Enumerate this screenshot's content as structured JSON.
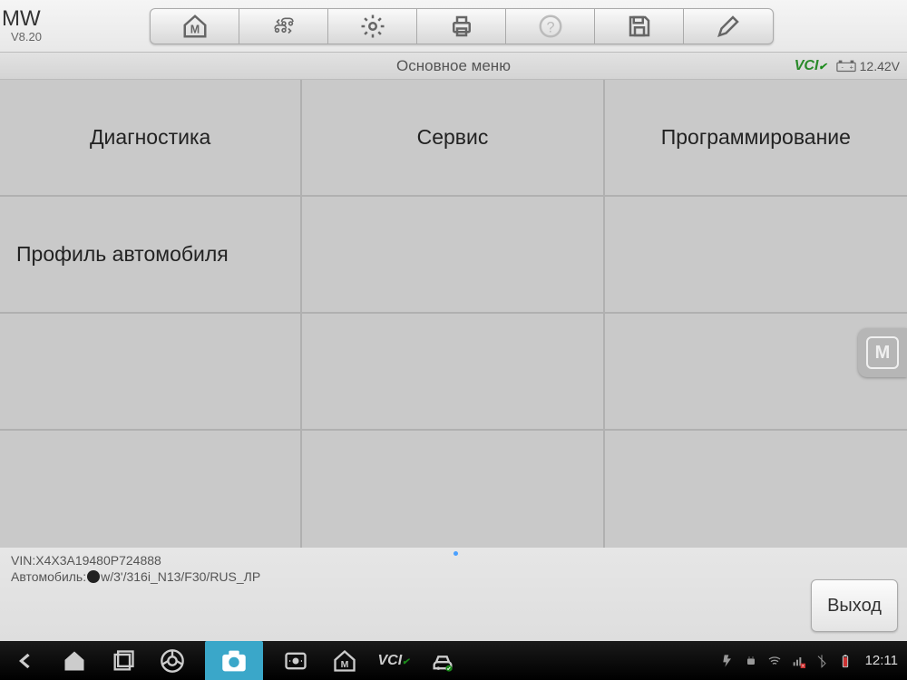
{
  "brand": {
    "name": "MW",
    "version": "V8.20"
  },
  "toolbar_icons": [
    "home",
    "vehicle",
    "settings",
    "print",
    "help",
    "save",
    "edit"
  ],
  "subheader": {
    "title": "Основное меню",
    "vci_label": "VCI",
    "voltage": "12.42V"
  },
  "menu": {
    "items": [
      "Диагностика",
      "Сервис",
      "Программирование",
      "Профиль автомобиля"
    ]
  },
  "footer": {
    "vin_label": "VIN:",
    "vin_value": "X4X3A19480P724888",
    "car_label": "Автомобиль:",
    "car_value": "w/3'/316i_N13/F30/RUS_ЛР",
    "exit_label": "Выход"
  },
  "float_button": "M",
  "navbar": {
    "time": "12:11"
  }
}
